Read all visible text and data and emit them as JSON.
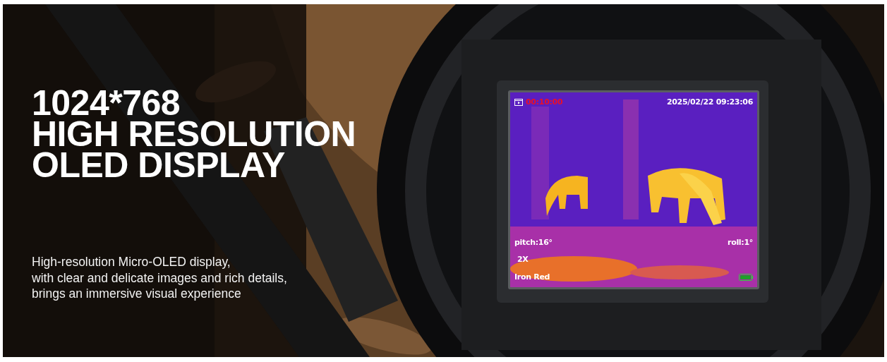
{
  "hero": {
    "heading_lines": [
      "1024*768",
      "HIGH RESOLUTION",
      "OLED DISPLAY"
    ],
    "description_lines": [
      "High-resolution Micro-OLED display,",
      "with clear and delicate images and rich details,",
      "brings an immersive visual experience"
    ]
  },
  "display": {
    "timer": "00:10:00",
    "datetime": "2025/02/22 09:23:06",
    "pitch": "pitch:16°",
    "roll": "roll:1°",
    "zoom": "2X",
    "palette": "Iron Red",
    "recording": true
  }
}
